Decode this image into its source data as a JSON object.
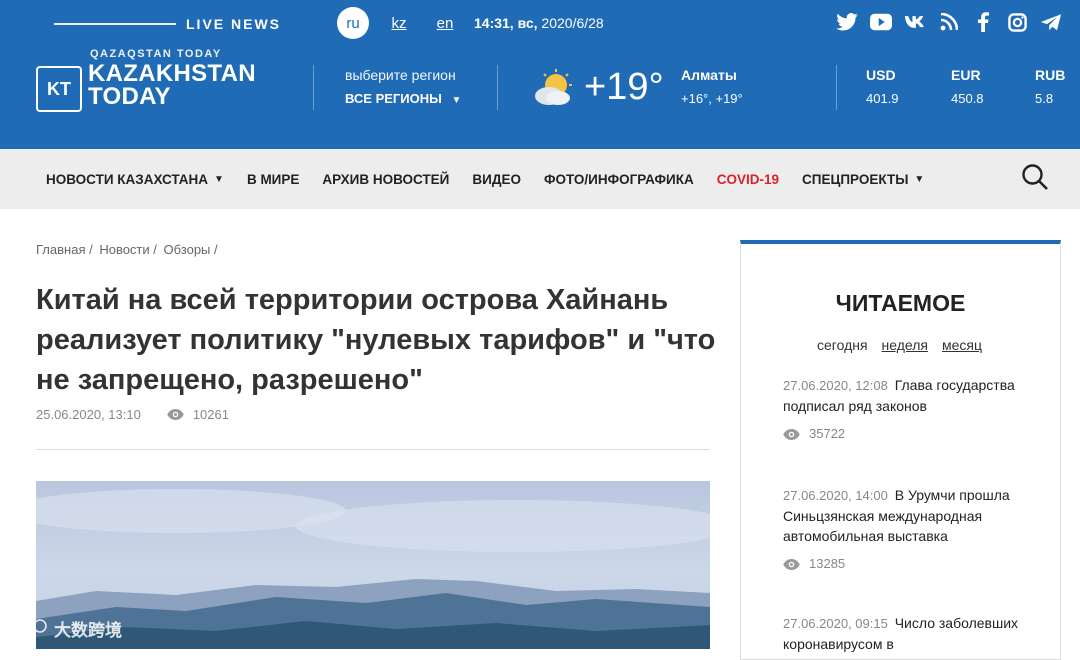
{
  "top": {
    "live_news": "LIVE NEWS",
    "languages": [
      {
        "label": "ru",
        "active": true
      },
      {
        "label": "kz",
        "active": false
      },
      {
        "label": "en",
        "active": false
      }
    ],
    "time": "14:31, вс,",
    "date": "2020/6/28",
    "socials": [
      "twitter-icon",
      "youtube-icon",
      "vk-icon",
      "rss-icon",
      "facebook-icon",
      "instagram-icon",
      "telegram-icon"
    ]
  },
  "logo": {
    "small": "QAZAQSTAN TODAY",
    "badge": "KT",
    "line1": "KAZAKHSTAN",
    "line2": "TODAY"
  },
  "region": {
    "label": "выберите регион",
    "value": "ВСЕ РЕГИОНЫ"
  },
  "weather": {
    "temp": "+19°",
    "city": "Алматы",
    "range": "+16°, +19°"
  },
  "currency": [
    {
      "code": "USD",
      "value": "401.9"
    },
    {
      "code": "EUR",
      "value": "450.8"
    },
    {
      "code": "RUB",
      "value": "5.8"
    }
  ],
  "nav": [
    {
      "label": "НОВОСТИ КАЗАХСТАНА",
      "caret": true
    },
    {
      "label": "В МИРЕ"
    },
    {
      "label": "АРХИВ НОВОСТЕЙ"
    },
    {
      "label": "ВИДЕО"
    },
    {
      "label": "ФОТО/ИНФОГРАФИКА"
    },
    {
      "label": "COVID-19",
      "red": true
    },
    {
      "label": "СПЕЦПРОЕКТЫ",
      "caret": true
    }
  ],
  "breadcrumbs": [
    "Главная",
    "Новости",
    "Обзоры"
  ],
  "article": {
    "title": "Китай на всей территории острова Хайнань реализует политику \"нулевых тарифов\" и \"что не запрещено, разрешено\"",
    "date": "25.06.2020, 13:10",
    "views": "10261"
  },
  "watermark": "大数跨境",
  "sidebar": {
    "title": "ЧИТАЕМОЕ",
    "tabs": [
      "сегодня",
      "неделя",
      "месяц"
    ],
    "items": [
      {
        "date": "27.06.2020, 12:08",
        "title": "Глава государства подписал ряд законов",
        "views": "35722"
      },
      {
        "date": "27.06.2020, 14:00",
        "title": "В Урумчи прошла Синьцзянская международная автомобильная выставка",
        "views": "13285"
      },
      {
        "date": "27.06.2020, 09:15",
        "title": "Число заболевших коронавирусом в",
        "views": ""
      }
    ]
  },
  "colors": {
    "header": "#1f6bb5",
    "nav_bg": "#ededed",
    "covid": "#d8232a"
  }
}
